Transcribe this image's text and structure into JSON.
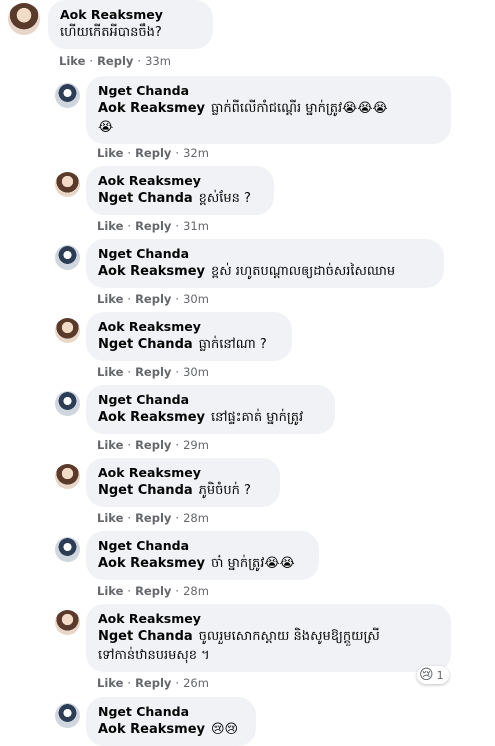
{
  "comments": [
    {
      "author": "Aok Reaksmey",
      "mention": "",
      "text": "ហើយកើតអីបានចឹង?",
      "like": "Like",
      "reply": "Reply",
      "time": "33m",
      "avatar": "aok"
    },
    {
      "author": "Nget Chanda",
      "mention": "Aok Reaksmey",
      "text": "ធ្លាក់ពីលើកាំជណ្ដើរ ម្នាក់ត្រូវ😭😭😭",
      "text2": "😭",
      "like": "Like",
      "reply": "Reply",
      "time": "32m",
      "avatar": "nget"
    },
    {
      "author": "Aok Reaksmey",
      "mention": "Nget Chanda",
      "text": "ខ្ពស់មែន ?",
      "like": "Like",
      "reply": "Reply",
      "time": "31m",
      "avatar": "aok"
    },
    {
      "author": "Nget Chanda",
      "mention": "Aok Reaksmey",
      "text": "ខ្ពស់ រហូតបណ្តាលឲ្យដាច់សរសៃឈាម",
      "like": "Like",
      "reply": "Reply",
      "time": "30m",
      "avatar": "nget"
    },
    {
      "author": "Aok Reaksmey",
      "mention": "Nget Chanda",
      "text": "ធ្លាក់នៅណា ?",
      "like": "Like",
      "reply": "Reply",
      "time": "30m",
      "avatar": "aok"
    },
    {
      "author": "Nget Chanda",
      "mention": "Aok Reaksmey",
      "text": "នៅផ្ទះគាត់ ម្នាក់ត្រូវ",
      "like": "Like",
      "reply": "Reply",
      "time": "29m",
      "avatar": "nget"
    },
    {
      "author": "Aok Reaksmey",
      "mention": "Nget Chanda",
      "text": "ភូមិចំបក់ ?",
      "like": "Like",
      "reply": "Reply",
      "time": "28m",
      "avatar": "aok"
    },
    {
      "author": "Nget Chanda",
      "mention": "Aok Reaksmey",
      "text": "ចា៎ ម្នាក់ត្រូវ😭😭",
      "like": "Like",
      "reply": "Reply",
      "time": "28m",
      "avatar": "nget"
    },
    {
      "author": "Aok Reaksmey",
      "mention": "Nget Chanda",
      "text": "ចូលរួមសោកស្តាយ និងសូមឱ្យក្តួយស្រី",
      "text2": "ទៅកាន់ឋានបរមសុខ ។",
      "like": "Like",
      "reply": "Reply",
      "time": "26m",
      "avatar": "aok",
      "reaction": {
        "emoji": "😢",
        "count": "1"
      }
    },
    {
      "author": "Nget Chanda",
      "mention": "Aok Reaksmey",
      "text": "😢😢",
      "like": "",
      "reply": "",
      "time": "",
      "avatar": "nget"
    }
  ]
}
